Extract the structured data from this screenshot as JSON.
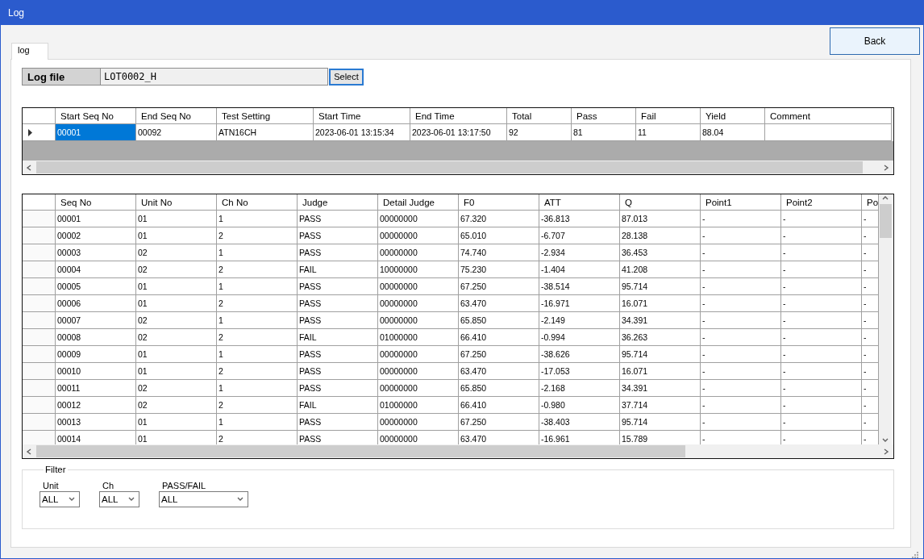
{
  "window": {
    "title": "Log"
  },
  "back_button": "Back",
  "tabs": [
    {
      "label": "log",
      "selected": true
    }
  ],
  "log_file": {
    "label": "Log file",
    "value": "LOT0002_H",
    "button": "Select"
  },
  "summary": {
    "columns": [
      "Start Seq No",
      "End Seq No",
      "Test Setting",
      "Start Time",
      "End Time",
      "Total",
      "Pass",
      "Fail",
      "Yield",
      "Comment"
    ],
    "rows": [
      {
        "current": true,
        "cells": [
          {
            "text": "00001",
            "selected": true
          },
          {
            "text": "00092",
            "selected": false
          },
          {
            "text": "ATN16CH",
            "selected": false
          },
          {
            "text": "2023-06-01 13:15:34",
            "selected": false
          },
          {
            "text": "2023-06-01 13:17:50",
            "selected": false
          },
          {
            "text": "92",
            "selected": false
          },
          {
            "text": "81",
            "selected": false
          },
          {
            "text": "11",
            "selected": false
          },
          {
            "text": "88.04",
            "selected": false
          },
          {
            "text": "",
            "selected": false
          }
        ]
      }
    ]
  },
  "details": {
    "columns": [
      "Seq No",
      "Unit No",
      "Ch No",
      "Judge",
      "Detail Judge",
      "F0",
      "ATT",
      "Q",
      "Point1",
      "Point2",
      "Po"
    ],
    "rows": [
      [
        "00001",
        "01",
        "1",
        "PASS",
        "00000000",
        "67.320",
        "-36.813",
        "87.013",
        "-",
        "-",
        "-"
      ],
      [
        "00002",
        "01",
        "2",
        "PASS",
        "00000000",
        "65.010",
        "-6.707",
        "28.138",
        "-",
        "-",
        "-"
      ],
      [
        "00003",
        "02",
        "1",
        "PASS",
        "00000000",
        "74.740",
        "-2.934",
        "36.453",
        "-",
        "-",
        "-"
      ],
      [
        "00004",
        "02",
        "2",
        "FAIL",
        "10000000",
        "75.230",
        "-1.404",
        "41.208",
        "-",
        "-",
        "-"
      ],
      [
        "00005",
        "01",
        "1",
        "PASS",
        "00000000",
        "67.250",
        "-38.514",
        "95.714",
        "-",
        "-",
        "-"
      ],
      [
        "00006",
        "01",
        "2",
        "PASS",
        "00000000",
        "63.470",
        "-16.971",
        "16.071",
        "-",
        "-",
        "-"
      ],
      [
        "00007",
        "02",
        "1",
        "PASS",
        "00000000",
        "65.850",
        "-2.149",
        "34.391",
        "-",
        "-",
        "-"
      ],
      [
        "00008",
        "02",
        "2",
        "FAIL",
        "01000000",
        "66.410",
        "-0.994",
        "36.263",
        "-",
        "-",
        "-"
      ],
      [
        "00009",
        "01",
        "1",
        "PASS",
        "00000000",
        "67.250",
        "-38.626",
        "95.714",
        "-",
        "-",
        "-"
      ],
      [
        "00010",
        "01",
        "2",
        "PASS",
        "00000000",
        "63.470",
        "-17.053",
        "16.071",
        "-",
        "-",
        "-"
      ],
      [
        "00011",
        "02",
        "1",
        "PASS",
        "00000000",
        "65.850",
        "-2.168",
        "34.391",
        "-",
        "-",
        "-"
      ],
      [
        "00012",
        "02",
        "2",
        "FAIL",
        "01000000",
        "66.410",
        "-0.980",
        "37.714",
        "-",
        "-",
        "-"
      ],
      [
        "00013",
        "01",
        "1",
        "PASS",
        "00000000",
        "67.250",
        "-38.403",
        "95.714",
        "-",
        "-",
        "-"
      ],
      [
        "00014",
        "01",
        "2",
        "PASS",
        "00000000",
        "63.470",
        "-16.961",
        "15.789",
        "-",
        "-",
        "-"
      ]
    ]
  },
  "filter": {
    "title": "Filter",
    "fields": [
      {
        "label": "Unit",
        "value": "ALL"
      },
      {
        "label": "Ch",
        "value": "ALL"
      },
      {
        "label": "PASS/FAIL",
        "value": "ALL"
      }
    ]
  }
}
